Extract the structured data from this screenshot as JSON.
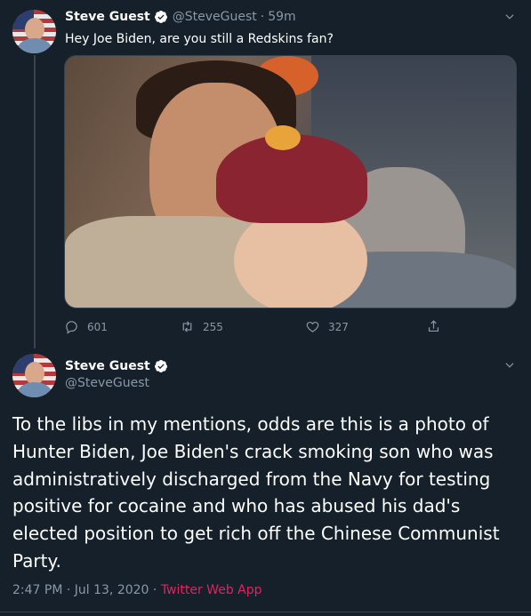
{
  "tweet1": {
    "display_name": "Steve Guest",
    "handle": "@SteveGuest",
    "separator": "·",
    "time": "59m",
    "text": "Hey Joe Biden, are you still a Redskins fan?",
    "actions": {
      "reply_count": "601",
      "retweet_count": "255",
      "like_count": "327"
    }
  },
  "tweet2": {
    "display_name": "Steve Guest",
    "handle": "@SteveGuest",
    "text": "To the libs in my mentions, odds are this is a photo of Hunter Biden, Joe Biden's crack smoking son who was administratively discharged from the Navy for testing positive for cocaine and who has abused his dad's elected position to get rich off the Chinese Communist Party.",
    "timestamp": "2:47 PM · Jul 13, 2020",
    "separator": "·",
    "source": "Twitter Web App"
  },
  "colors": {
    "background": "#15202b",
    "secondary_text": "#8899a6",
    "verified_blue": "#1da1f2",
    "source_link": "#e0245e"
  },
  "icons": [
    "chevron-down-icon",
    "verified-badge-icon",
    "reply-icon",
    "retweet-icon",
    "like-icon",
    "share-icon"
  ]
}
